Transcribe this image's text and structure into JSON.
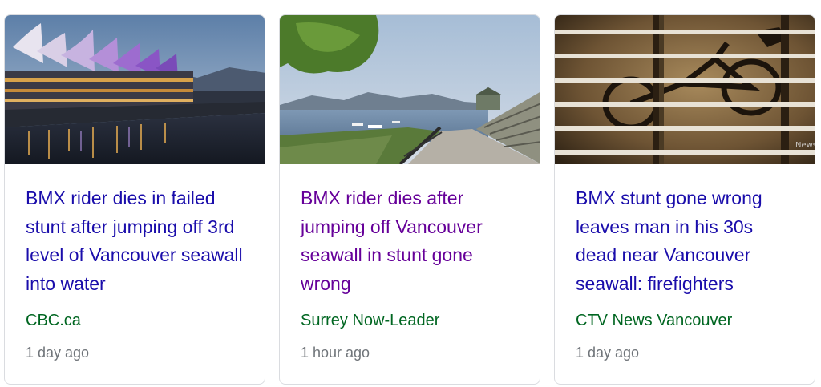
{
  "cards": [
    {
      "headline": "BMX rider dies in failed stunt after jumping off 3rd level of Vancouver seawall into water",
      "source": "CBC.ca",
      "time": "1 day ago",
      "visited": false,
      "image": "canada-place-night-photo"
    },
    {
      "headline": "BMX rider dies after jumping off Vancouver seawall in stunt gone wrong",
      "source": "Surrey Now-Leader",
      "time": "1 hour ago",
      "visited": true,
      "image": "seawall-path-photo"
    },
    {
      "headline": "BMX stunt gone wrong leaves man in his 30s dead near Vancouver seawall: firefighters",
      "source": "CTV News Vancouver",
      "time": "1 day ago",
      "visited": false,
      "image": "bicycle-behind-railing-photo",
      "image_watermark": "News"
    }
  ],
  "colors": {
    "link": "#1a0dab",
    "visited_link": "#660099",
    "source": "#006621",
    "time": "#70757a",
    "border": "#dadce0"
  }
}
